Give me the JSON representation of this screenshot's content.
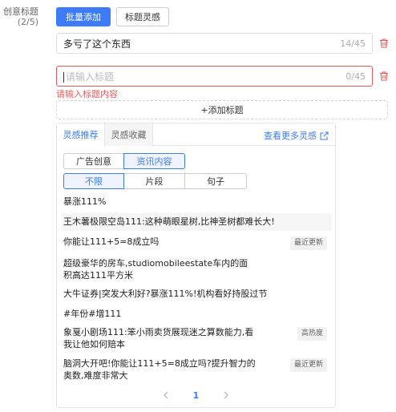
{
  "field": {
    "label": "创意标题",
    "count": "(2/5)"
  },
  "toolbar": {
    "batch_add": "批量添加",
    "title_idea": "标题灵感"
  },
  "titles": [
    {
      "text": "多亏了这个东西",
      "counter": "14/45"
    },
    {
      "placeholder": "请输入标题",
      "counter": "0/45",
      "error": "请输入标题内容"
    }
  ],
  "add_title": "+添加标题",
  "panel": {
    "tabs": [
      "灵感推荐",
      "灵感收藏"
    ],
    "more": "查看更多灵感",
    "source": [
      "广告创意",
      "资讯内容"
    ],
    "length": [
      "不限",
      "片段",
      "句子"
    ],
    "items": [
      {
        "text": "暴涨111%"
      },
      {
        "text": "王木薯极限空岛111:这种萌眼星树,比神圣树都难长大!"
      },
      {
        "text": "你能让111+5=8成立吗",
        "badge": "最近更新"
      },
      {
        "text": "超级豪华的房车,studiomobileestate车内的面积高达111平方米"
      },
      {
        "text": "大牛证券|突发大利好?暴涨111%!机构看好持股过节"
      },
      {
        "text": "#年份#增111"
      },
      {
        "text": "象戛小剧场111:笨小雨卖货展现迷之算数能力,看我让他如何赔本",
        "badge": "高热度"
      },
      {
        "text": "脑洞大开吧!你能让111+5=8成立吗?提升智力的奥数,难度非常大",
        "badge": "最近更新"
      }
    ],
    "pagination": {
      "current": "1"
    }
  },
  "colors": {
    "primary": "#3d7bf7",
    "error": "#e85b5b"
  }
}
